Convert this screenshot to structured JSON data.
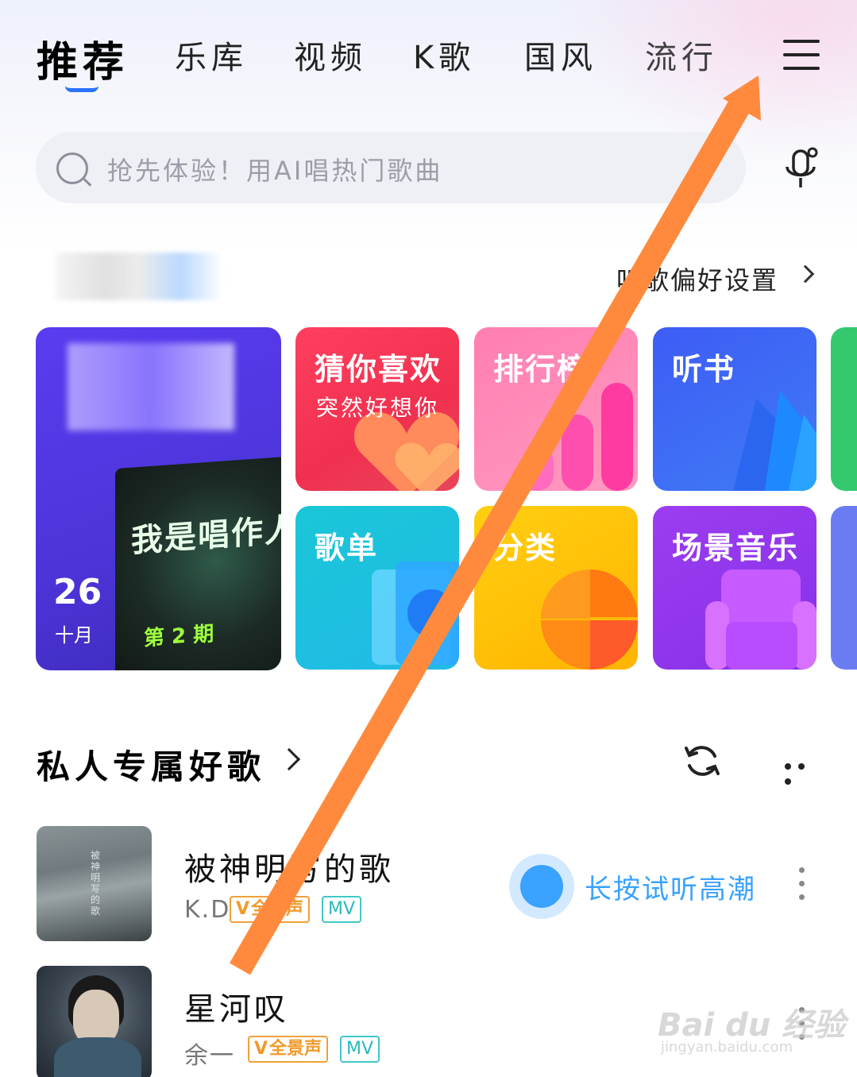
{
  "tabs": [
    {
      "label": "推荐",
      "active": true
    },
    {
      "label": "乐库"
    },
    {
      "label": "视频"
    },
    {
      "label": "K歌"
    },
    {
      "label": "国风"
    },
    {
      "label": "流行"
    }
  ],
  "search": {
    "placeholder": "抢先体验！用AI唱热门歌曲"
  },
  "prefs_link": "听歌偏好设置",
  "cards": {
    "big": {
      "day": "26",
      "month": "十月",
      "poster_title": "我是唱作人",
      "poster_episode": "第 2 期"
    },
    "guess": {
      "title": "猜你喜欢",
      "subtitle": "突然好想你"
    },
    "rank": {
      "title": "排行榜"
    },
    "book": {
      "title": "听书"
    },
    "playlist": {
      "title": "歌单"
    },
    "category": {
      "title": "分类"
    },
    "scene": {
      "title": "场景音乐"
    }
  },
  "section": {
    "title": "私人专属好歌"
  },
  "songs": [
    {
      "title": "被神明写的歌",
      "artist": "K.D",
      "badge_vip": "全景声",
      "badge_mv": "MV",
      "preview_hint": "长按试听高潮",
      "cover_text": "被神明写的歌"
    },
    {
      "title": "星河叹",
      "artist": "余一",
      "badge_vip": "全景声",
      "badge_mv": "MV"
    }
  ],
  "watermark": {
    "brand": "Bai du 经验",
    "url": "jingyan.baidu.com"
  },
  "colors": {
    "accent": "#2a73ff",
    "preview": "#3aa2ff",
    "arrow": "#ff8a3d"
  }
}
